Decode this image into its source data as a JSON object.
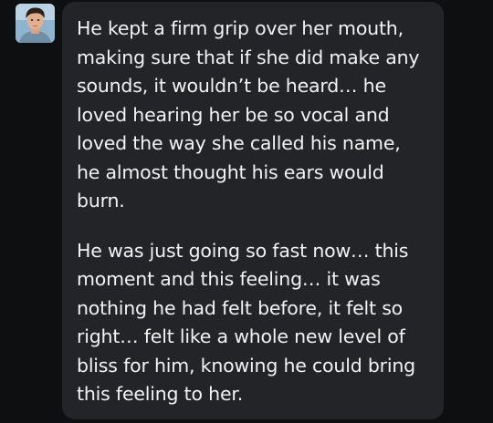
{
  "message": {
    "paragraphs": [
      "He kept a firm grip over her mouth, making sure that if she did make any sounds, it wouldn’t be heard… he loved hearing her be so vocal and loved the way she called his name, he almost thought his ears would burn.",
      "He was just going so fast now… this moment and this feeling… it was nothing he had felt before, it felt so right… felt like a whole new level of bliss for him, knowing he could bring this feeling to her."
    ]
  },
  "colors": {
    "page_background": "#0e0f11",
    "bubble_background": "#232427",
    "text": "#f2f2f2"
  },
  "icons": {
    "avatar": "character-avatar"
  }
}
